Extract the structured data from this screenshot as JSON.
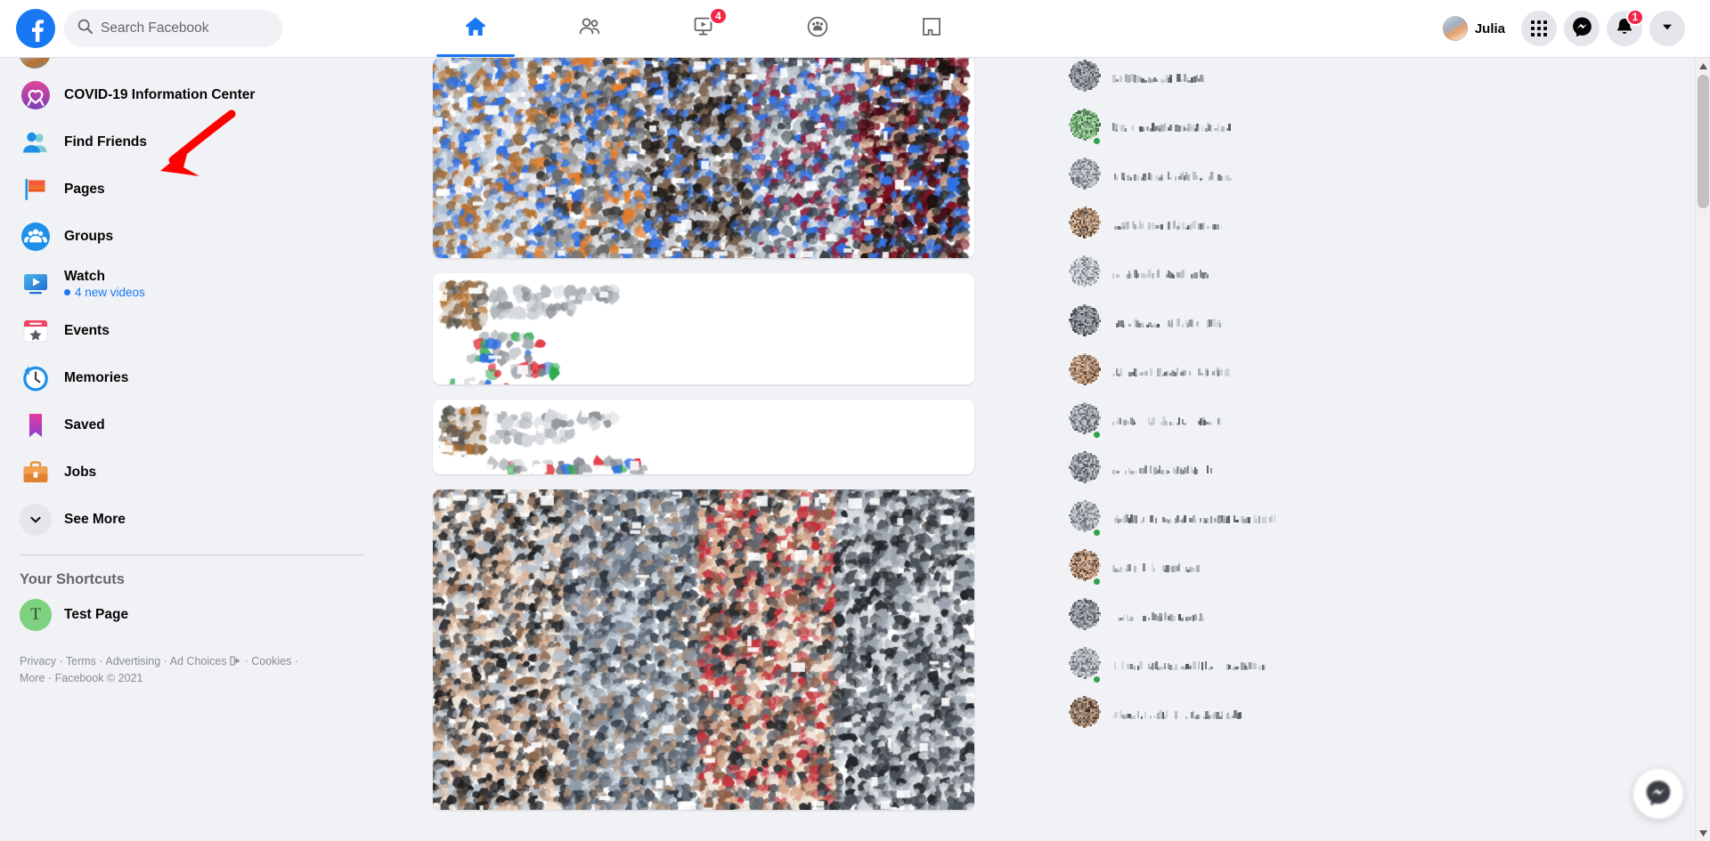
{
  "app": {
    "title": "Facebook",
    "brand_color": "#1877f2",
    "badge_color": "#f02849"
  },
  "topbar": {
    "logo_icon": "facebook-logo-icon",
    "search": {
      "placeholder": "Search Facebook",
      "value": "",
      "icon": "search-icon"
    },
    "nav_tabs": [
      {
        "key": "home",
        "icon": "home-icon",
        "label": "Home",
        "active": true,
        "badge": ""
      },
      {
        "key": "friends",
        "icon": "friends-icon",
        "label": "Friends",
        "active": false,
        "badge": ""
      },
      {
        "key": "watch",
        "icon": "watch-video-icon",
        "label": "Watch",
        "active": false,
        "badge": "4"
      },
      {
        "key": "groups",
        "icon": "groups-circle-icon",
        "label": "Groups",
        "active": false,
        "badge": ""
      },
      {
        "key": "gaming",
        "icon": "gaming-icon",
        "label": "Gaming",
        "active": false,
        "badge": ""
      }
    ],
    "profile": {
      "name": "Julia",
      "avatar": "user-avatar"
    },
    "actions": [
      {
        "key": "menu",
        "icon": "grid-menu-icon",
        "label": "Menu",
        "badge": ""
      },
      {
        "key": "messenger",
        "icon": "messenger-icon",
        "label": "Messenger",
        "badge": ""
      },
      {
        "key": "notifications",
        "icon": "bell-icon",
        "label": "Notifications",
        "badge": "1"
      },
      {
        "key": "account",
        "icon": "chevron-down-icon",
        "label": "Account",
        "badge": ""
      }
    ]
  },
  "sidebar": {
    "items": [
      {
        "label": "COVID-19 Information Center",
        "icon": "covid-heart-icon",
        "sub": ""
      },
      {
        "label": "Find Friends",
        "icon": "find-friends-icon",
        "sub": ""
      },
      {
        "label": "Pages",
        "icon": "pages-flag-icon",
        "sub": ""
      },
      {
        "label": "Groups",
        "icon": "groups-icon",
        "sub": ""
      },
      {
        "label": "Watch",
        "icon": "watch-icon",
        "sub": "4 new videos"
      },
      {
        "label": "Events",
        "icon": "events-calendar-icon",
        "sub": ""
      },
      {
        "label": "Memories",
        "icon": "memories-clock-icon",
        "sub": ""
      },
      {
        "label": "Saved",
        "icon": "saved-bookmark-icon",
        "sub": ""
      },
      {
        "label": "Jobs",
        "icon": "jobs-briefcase-icon",
        "sub": ""
      },
      {
        "label": "See More",
        "icon": "chevron-down-icon",
        "sub": ""
      }
    ],
    "shortcuts_title": "Your Shortcuts",
    "shortcuts": [
      {
        "label": "Test Page",
        "avatar_initial": "T",
        "avatar_color": "#7ed17e"
      }
    ],
    "footer": {
      "links": [
        "Privacy",
        "Terms",
        "Advertising",
        "Ad Choices",
        "Cookies",
        "More"
      ],
      "copyright": "Facebook © 2021",
      "adchoices_icon": "ad-choices-icon",
      "separator": "·"
    }
  },
  "feed": {
    "cards": [
      {
        "type": "photo-post",
        "redacted": true
      },
      {
        "type": "text-post",
        "redacted": true
      },
      {
        "type": "link-post",
        "redacted": true
      },
      {
        "type": "photo-post",
        "redacted": true
      }
    ]
  },
  "rightbar": {
    "contacts": [
      {
        "online": false,
        "redacted": true
      },
      {
        "online": true,
        "redacted": true
      },
      {
        "online": false,
        "redacted": true
      },
      {
        "online": false,
        "redacted": true
      },
      {
        "online": false,
        "redacted": true
      },
      {
        "online": false,
        "redacted": true
      },
      {
        "online": false,
        "redacted": true
      },
      {
        "online": true,
        "redacted": true
      },
      {
        "online": false,
        "redacted": true
      },
      {
        "online": true,
        "redacted": true
      },
      {
        "online": true,
        "redacted": true
      },
      {
        "online": false,
        "redacted": true
      },
      {
        "online": true,
        "redacted": true
      },
      {
        "online": false,
        "redacted": true
      }
    ],
    "fab": {
      "icon": "messenger-new-chat-icon"
    }
  },
  "annotation": {
    "type": "arrow",
    "color": "#ff0000",
    "points_to": "Pages"
  },
  "scrollbar": {
    "up_icon": "triangle-up-icon",
    "down_icon": "triangle-down-icon",
    "thumb_position_pct": 2
  }
}
